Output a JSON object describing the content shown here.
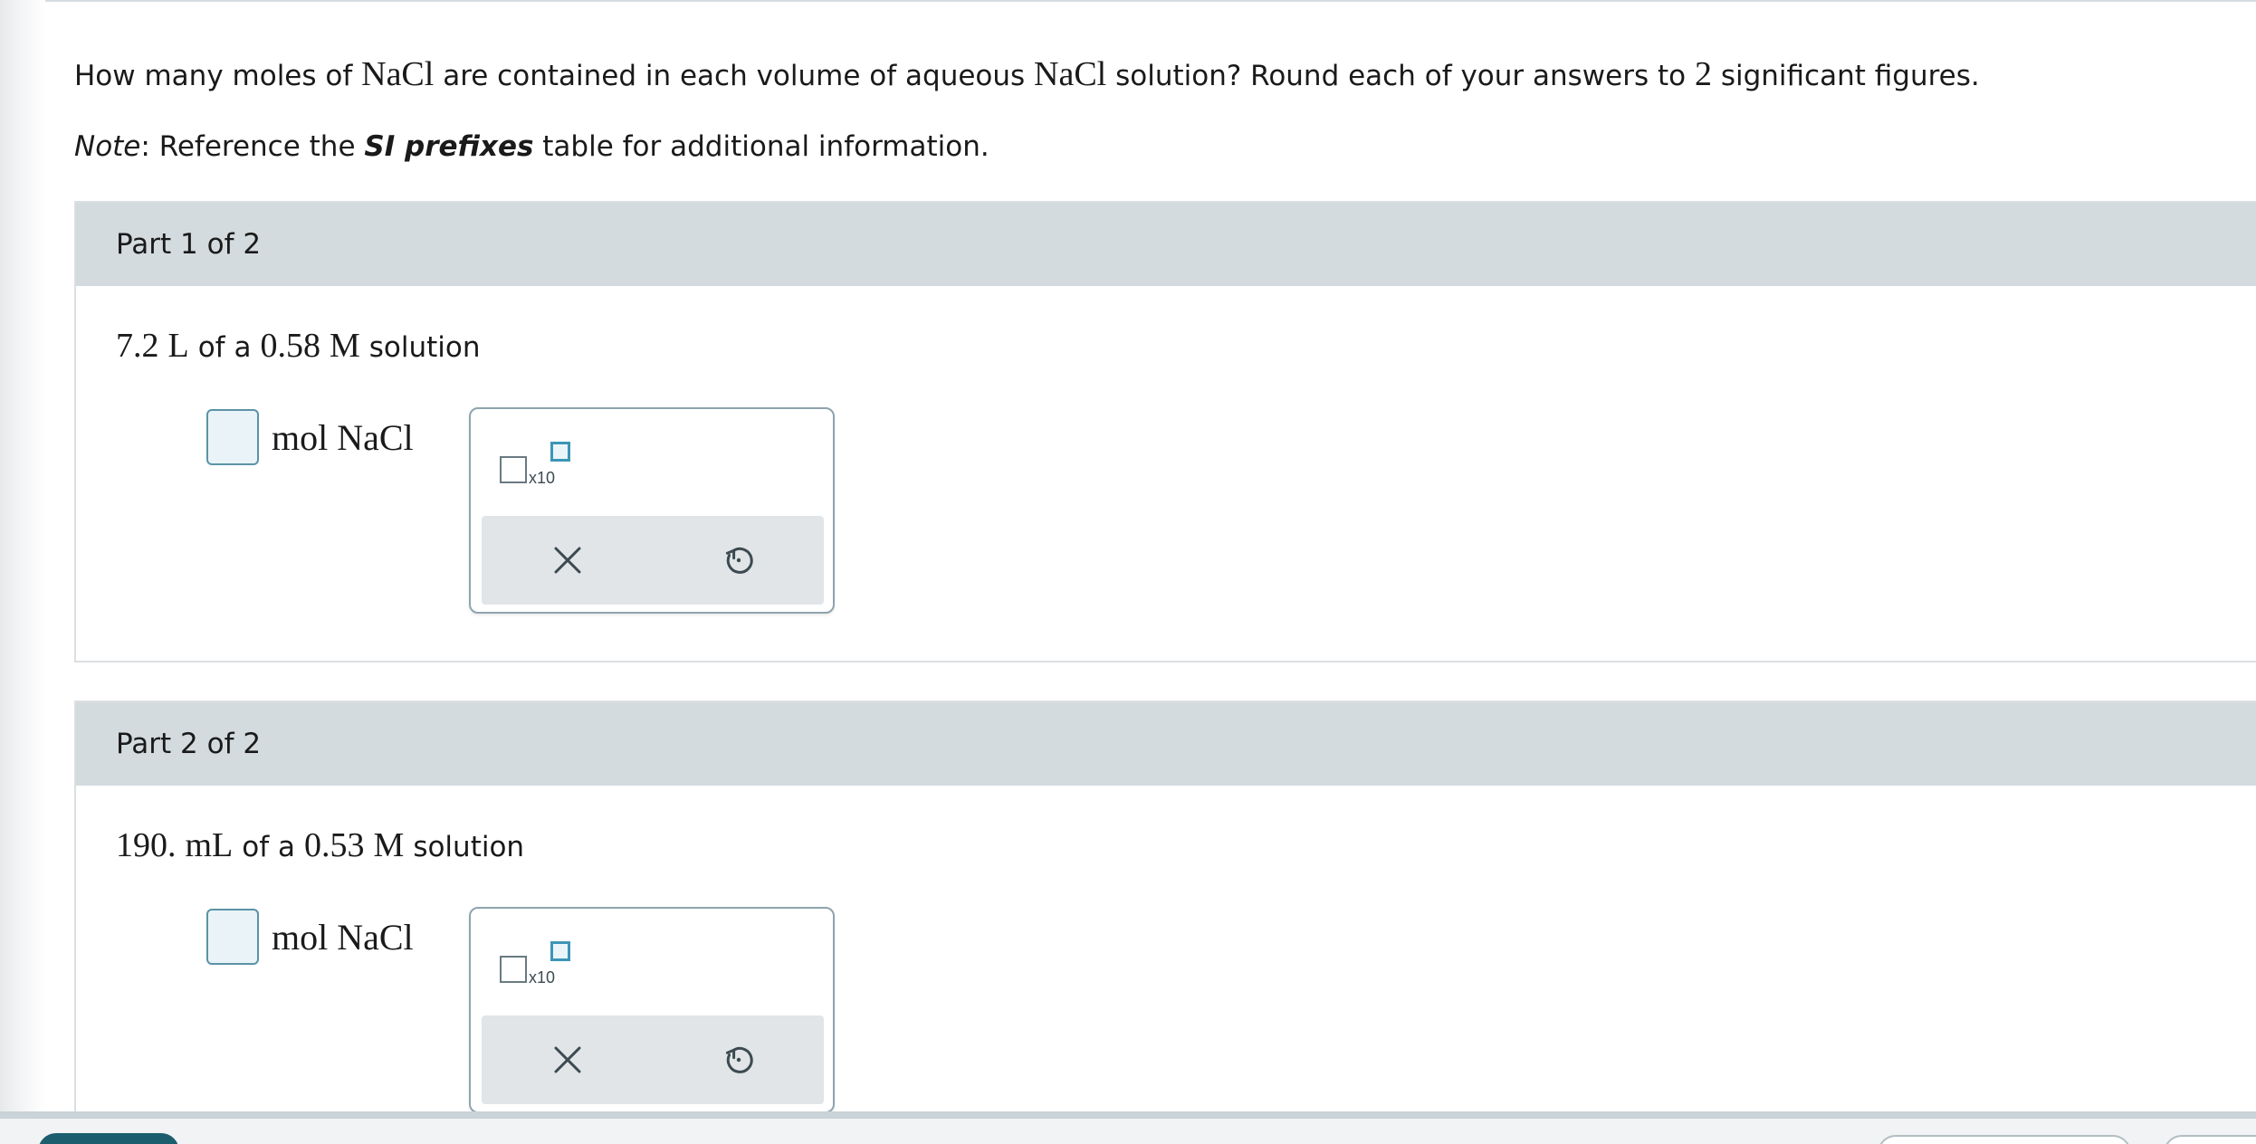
{
  "question": {
    "part_a": "How many moles of ",
    "formula_1": "NaCl",
    "part_b": " are contained in each volume of aqueous ",
    "formula_2": "NaCl",
    "part_c": " solution? Round each of your answers to ",
    "sig_figs": "2",
    "part_d": " significant figures."
  },
  "note": {
    "label": "Note",
    "text_a": ": Reference the ",
    "link": "SI prefixes",
    "text_b": " table for additional information."
  },
  "parts": [
    {
      "header": "Part 1 of 2",
      "volume": "7.2",
      "volume_unit": "L",
      "of_a": "of a",
      "molarity": "0.58",
      "molarity_unit": "M",
      "suffix": "solution",
      "answer_value": "",
      "answer_unit": "mol NaCl",
      "x10_label": "x10"
    },
    {
      "header": "Part 2 of 2",
      "volume": "190.",
      "volume_unit": "mL",
      "of_a": "of a",
      "molarity": "0.53",
      "molarity_unit": "M",
      "suffix": "solution",
      "answer_value": "",
      "answer_unit": "mol NaCl",
      "x10_label": "x10"
    }
  ],
  "icons": {
    "clear": "close-icon",
    "undo": "undo-icon",
    "sci_notation": "scientific-notation-icon"
  },
  "colors": {
    "part_header_bg": "#d3dbde",
    "answer_box_border": "#5b93a6",
    "answer_box_fill": "#e9f3f8",
    "exponent_box": "#3d95b7",
    "tool_actions_bg": "#e1e5e7",
    "primary_button": "#1c5e6e"
  }
}
